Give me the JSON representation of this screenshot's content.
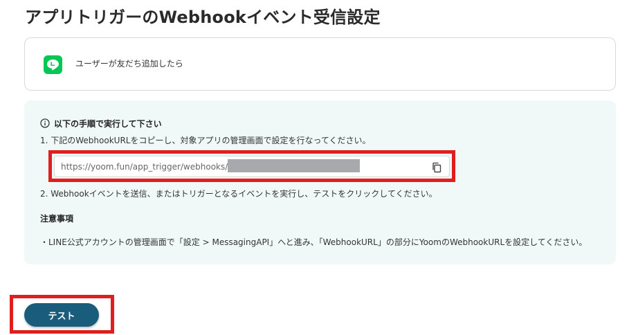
{
  "page": {
    "title": "アプリトリガーのWebhookイベント受信設定"
  },
  "trigger": {
    "app_icon": "line-logo-icon",
    "app_color": "#06c755",
    "label": "ユーザーが友だち追加したら"
  },
  "instructions": {
    "heading_icon": "info-icon",
    "heading": "以下の手順で実行して下さい",
    "step1": "1. 下記のWebhookURLをコピーし、対象アプリの管理画面で設定を行なってください。",
    "webhook_url": "https://yoom.fun/app_trigger/webhooks/",
    "copy_icon": "copy-icon",
    "step2": "2. Webhookイベントを送信、またはトリガーとなるイベントを実行し、テストをクリックしてください。",
    "note_title": "注意事項",
    "note_text": "・LINE公式アカウントの管理画面で「設定 > MessagingAPI」へと進み、「WebhookURL」の部分にYoomのWebhookURLを設定してください。"
  },
  "actions": {
    "test_label": "テスト",
    "test_color": "#1a5c7b"
  },
  "annotations": {
    "highlight_color": "#e01e1e"
  }
}
